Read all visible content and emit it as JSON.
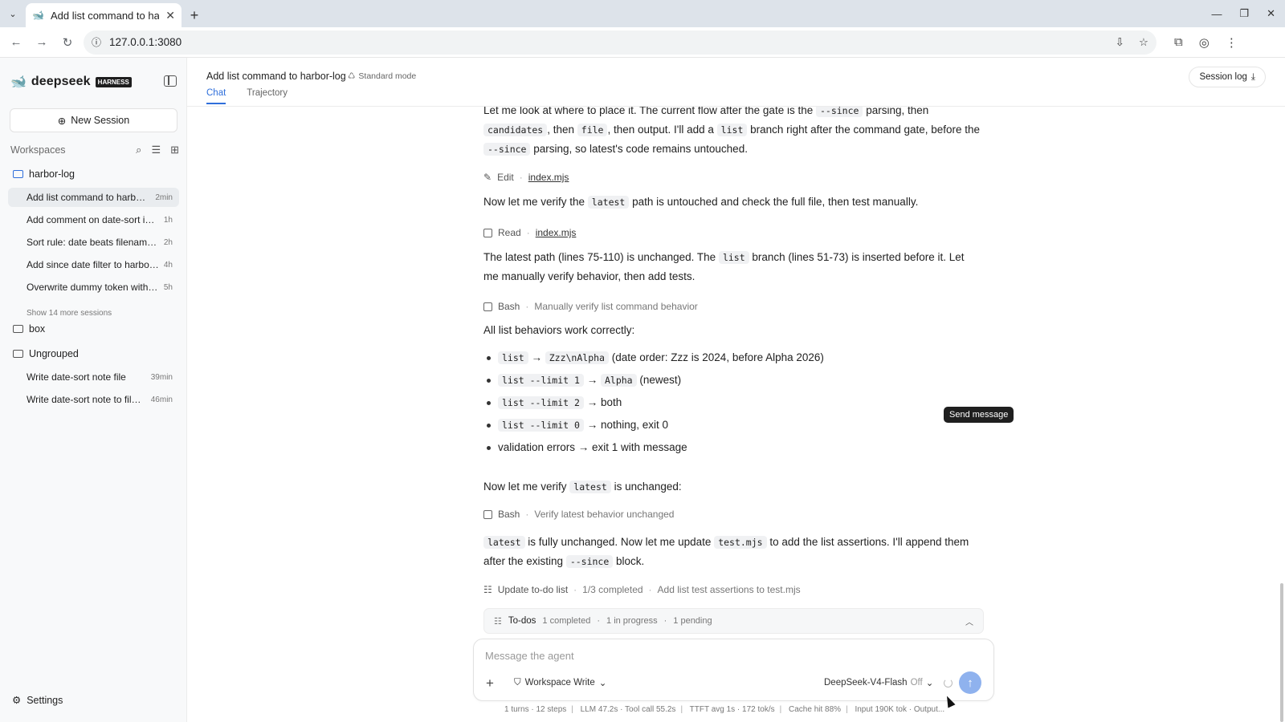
{
  "browser": {
    "tab_title": "Add list command to harbor-log",
    "url": "127.0.0.1:3080"
  },
  "sidebar": {
    "brand": "deepseek",
    "badge": "HARNESS",
    "new_session": "New Session",
    "workspaces_label": "Workspaces",
    "folders": {
      "harbor": "harbor-log",
      "box": "box",
      "ungrouped": "Ungrouped"
    },
    "harbor_sessions": [
      {
        "title": "Add list command to harbor-log",
        "age": "2min"
      },
      {
        "title": "Add comment on date-sort in index.mjs",
        "age": "1h"
      },
      {
        "title": "Sort rule: date beats filename order",
        "age": "2h"
      },
      {
        "title": "Add since date filter to harbor-log",
        "age": "4h"
      },
      {
        "title": "Overwrite dummy token with real one",
        "age": "5h"
      }
    ],
    "show_more": "Show 14 more sessions",
    "ungrouped_sessions": [
      {
        "title": "Write date-sort note file",
        "age": "39min"
      },
      {
        "title": "Write date-sort note to file notes",
        "age": "46min"
      }
    ],
    "settings": "Settings"
  },
  "header": {
    "title": "Add list command to harbor-log",
    "mode": "Standard mode",
    "tabs": [
      "Chat",
      "Trajectory"
    ],
    "session_log": "Session log"
  },
  "chat": {
    "p1": {
      "a": "Let me look at where to place it. The current flow after the gate is the ",
      "c1": "--since",
      "b": " parsing, then ",
      "c2": "candidates",
      "d": ", then ",
      "c3": "file",
      "e": ", then output. I'll add a ",
      "c4": "list",
      "f": " branch right after the command gate, before the ",
      "c5": "--since",
      "g": " parsing, so latest's code remains untouched."
    },
    "tool1": {
      "name": "Edit",
      "file": "index.mjs"
    },
    "p2": {
      "a": "Now let me verify the ",
      "c1": "latest",
      "b": " path is untouched and check the full file, then test manually."
    },
    "tool2": {
      "name": "Read",
      "file": "index.mjs"
    },
    "p3": {
      "a": "The latest path (lines 75-110) is unchanged. The ",
      "c1": "list",
      "b": " branch (lines 51-73) is inserted before it. Let me manually verify behavior, then add tests."
    },
    "tool3": {
      "name": "Bash",
      "desc": "Manually verify list command behavior"
    },
    "p4": "All list behaviors work correctly:",
    "bullets": [
      {
        "code": "list",
        "arrow": "→",
        "code2": "Zzz\\nAlpha",
        "rest": "(date order: Zzz is 2024, before Alpha 2026)"
      },
      {
        "code": "list --limit 1",
        "arrow": "→",
        "code2": "Alpha",
        "rest": "(newest)"
      },
      {
        "code": "list --limit 2",
        "arrow": "→",
        "rest": "both"
      },
      {
        "code": "list --limit 0",
        "arrow": "→",
        "rest": "nothing, exit 0"
      },
      {
        "text": "validation errors → exit 1 with message"
      }
    ],
    "p5": {
      "a": "Now let me verify ",
      "c1": "latest",
      "b": " is unchanged:"
    },
    "tool4": {
      "name": "Bash",
      "desc": "Verify latest behavior unchanged"
    },
    "p6": {
      "c1": "latest",
      "a": " is fully unchanged. Now let me update ",
      "c2": "test.mjs",
      "b": " to add the list assertions. I'll append them after the existing ",
      "c3": "--since",
      "c": " block."
    },
    "tool5": {
      "name": "Update to-do list",
      "progress": "1/3 completed",
      "desc": "Add list test assertions to test.mjs"
    }
  },
  "todos": {
    "label": "To-dos",
    "completed": "1 completed",
    "in_progress": "1 in progress",
    "pending": "1 pending"
  },
  "tooltip": "Send message",
  "composer": {
    "placeholder": "Message the agent",
    "permission": "Workspace Write",
    "model": "DeepSeek-V4-Flash",
    "thinking": "Off"
  },
  "stats": [
    "1 turns · 12 steps",
    "LLM 47.2s · Tool call 55.2s",
    "TTFT avg 1s · 172 tok/s",
    "Cache hit 88%",
    "Input 190K tok · Output..."
  ]
}
